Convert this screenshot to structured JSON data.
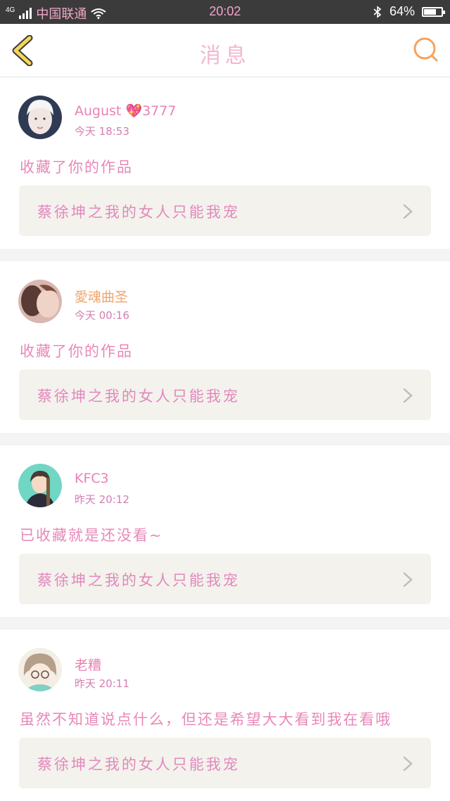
{
  "status_bar": {
    "network": "4G",
    "carrier": "中国联通",
    "time": "20:02",
    "battery": "64%",
    "battery_level": 0.64
  },
  "header": {
    "title": "消息",
    "back_icon": "chevron-left-icon",
    "search_icon": "search-icon"
  },
  "notifications": [
    {
      "user": "August 💖3777",
      "time": "今天 18:53",
      "message": "收藏了你的作品",
      "work_title": "蔡徐坤之我的女人只能我宠"
    },
    {
      "user": "愛魂曲圣",
      "time": "今天 00:16",
      "message": "收藏了你的作品",
      "work_title": "蔡徐坤之我的女人只能我宠"
    },
    {
      "user": "KFC3",
      "time": "昨天 20:12",
      "message": "已收藏就是还没看~",
      "work_title": "蔡徐坤之我的女人只能我宠"
    },
    {
      "user": "老糟",
      "time": "昨天 20:11",
      "message": "虽然不知道说点什么，但还是希望大大看到我在看哦",
      "work_title": "蔡徐坤之我的女人只能我宠"
    }
  ],
  "colors": {
    "accent_pink": "#e888b9",
    "title_pink": "#f3b6cf",
    "back_yellow": "#f5d65a",
    "search_orange": "#f6a25e"
  }
}
